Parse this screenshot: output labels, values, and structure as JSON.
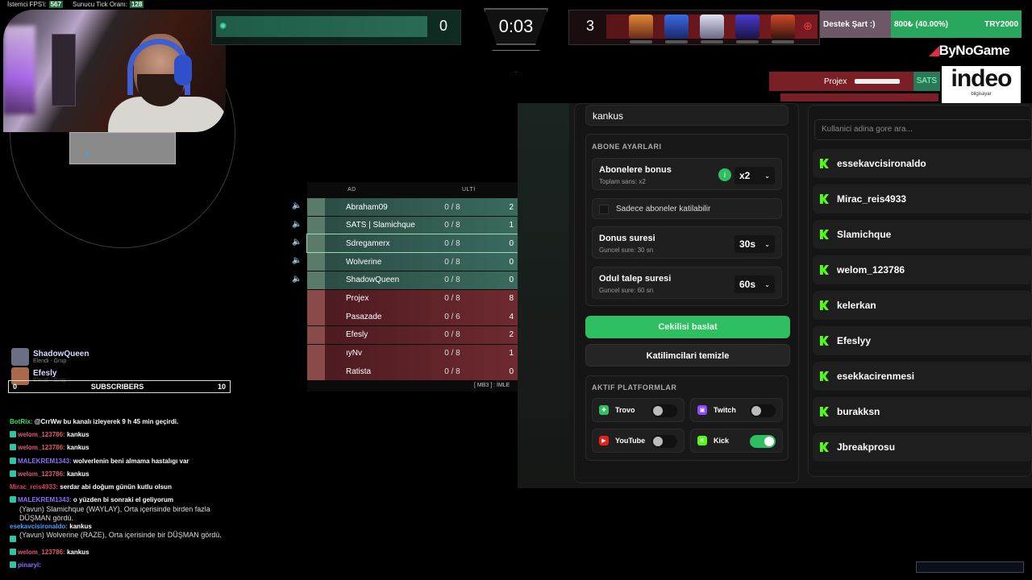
{
  "stats": {
    "client_fps_label": "İstemci FPS'i:",
    "client_fps": "567",
    "server_tick_label": "Sunucu Tick Oranı:",
    "server_tick": "128"
  },
  "hud": {
    "score_left": "0",
    "timer": "0:03",
    "score_right": "3"
  },
  "donation": {
    "label": "Destek Şart :)",
    "progress_text": "800₺ (40.00%)",
    "goal": "TRY2000",
    "progress": 0.4
  },
  "sponsors": {
    "bynogame": "ByNoGame",
    "indeo": "indeo",
    "indeo_sub": "bilgisayar"
  },
  "killfeed": {
    "player": "Projex",
    "tag": "SATS"
  },
  "scoreboard": {
    "headers": {
      "name": "AD",
      "ult": "ULTİ"
    },
    "rows": [
      {
        "name": "Abraham09",
        "ult": "0 / 8",
        "k": "2",
        "team": "ally"
      },
      {
        "name": "SATS | Slamichque",
        "ult": "0 / 8",
        "k": "1",
        "team": "ally"
      },
      {
        "name": "Sdregamerx",
        "ult": "0 / 8",
        "k": "0",
        "team": "ally"
      },
      {
        "name": "Wolverine",
        "ult": "0 / 8",
        "k": "0",
        "team": "ally"
      },
      {
        "name": "ShadowQueen",
        "ult": "0 / 8",
        "k": "0",
        "team": "ally"
      },
      {
        "name": "Projex",
        "ult": "0 / 8",
        "k": "8",
        "team": "enemy"
      },
      {
        "name": "Pasazade",
        "ult": "0 / 6",
        "k": "4",
        "team": "enemy"
      },
      {
        "name": "Efesly",
        "ult": "0 / 8",
        "k": "2",
        "team": "enemy"
      },
      {
        "name": "ıyNv",
        "ult": "0 / 8",
        "k": "1",
        "team": "enemy"
      },
      {
        "name": "Ratista",
        "ult": "0 / 8",
        "k": "0",
        "team": "enemy"
      }
    ],
    "footer": "[ MB3 ] : İMLE"
  },
  "toasts": [
    {
      "name": "ShadowQueen",
      "sub": "Elendi - Grup"
    },
    {
      "name": "Efesly",
      "sub": "Elendi - Grup"
    }
  ],
  "subscribers": {
    "left": "0",
    "label": "SUBSCRIBERS",
    "right": "10"
  },
  "chat": [
    {
      "user": "BotRix:",
      "color": "#43e05a",
      "msg": "@CrrWw bu kanalı izleyerek 9 h 45 min geçirdi.",
      "badge": false
    },
    {
      "user": "welom_123786:",
      "color": "#e05a6a",
      "msg": "kankus",
      "badge": true
    },
    {
      "user": "welom_123786:",
      "color": "#e05a6a",
      "msg": "kankus",
      "badge": true
    },
    {
      "user": "MALEKREM1343:",
      "color": "#8f6cff",
      "msg": "wolverlenin beni almama hastalıgı var",
      "badge": true
    },
    {
      "user": "welom_123786:",
      "color": "#e05a6a",
      "msg": "kankus",
      "badge": true
    },
    {
      "user": "Mirac_reis4933:",
      "color": "#d9435a",
      "msg": "serdar abi doğum günün kutlu olsun",
      "badge": false
    },
    {
      "user": "MALEKREM1343:",
      "color": "#8f6cff",
      "msg": "o yüzden bi sonraki el geliyorum",
      "badge": true
    },
    {
      "user": "",
      "color": "#ffffff",
      "msg": "",
      "badge": false
    },
    {
      "user": "esekavcisironaldo:",
      "color": "#4aa0ff",
      "msg": "kankus",
      "badge": false
    },
    {
      "user": "",
      "color": "#ffffff",
      "msg": "",
      "badge": true
    },
    {
      "user": "welom_123786:",
      "color": "#e05a6a",
      "msg": "kankus",
      "badge": true
    },
    {
      "user": "pinaryl:",
      "color": "#8f6cff",
      "msg": "",
      "badge": true
    }
  ],
  "events": {
    "e1": "(Yavun) Slamichque (WAYLAY), Orta  içerisinde birden fazla DÜŞMAN gördü.",
    "e2": "(Yavun) Wolverine (RAZE), Orta  içerisinde bir DÜŞMAN gördü."
  },
  "panel": {
    "keyword": "kankus",
    "sub_settings_title": "ABONE AYARLARI",
    "sub_bonus_label": "Abonelere bonus",
    "sub_bonus_sub": "Toplam sans: x2",
    "sub_bonus_value": "x2",
    "subs_only_label": "Sadece aboneler katilabilir",
    "spin_label": "Donus suresi",
    "spin_sub": "Guncel sure: 30 sn",
    "spin_value": "30s",
    "claim_label": "Odul talep suresi",
    "claim_sub": "Guncel sure: 60 sn",
    "claim_value": "60s",
    "start_button": "Cekilisi baslat",
    "clear_button": "Katilimcilari temizle",
    "platforms_title": "AKTIF PLATFORMLAR",
    "platforms": [
      {
        "name": "Trovo",
        "on": false,
        "color": "#2fbf62"
      },
      {
        "name": "Twitch",
        "on": false,
        "color": "#9146ff"
      },
      {
        "name": "YouTube",
        "on": false,
        "color": "#e62117"
      },
      {
        "name": "Kick",
        "on": true,
        "color": "#53fc18"
      }
    ],
    "search_placeholder": "Kullanici adina gore ara...",
    "participants": [
      "essekavcisironaldo",
      "Mirac_reis4933",
      "Slamichque",
      "welom_123786",
      "kelerkan",
      "Efeslyy",
      "esekkacirenmesi",
      "burakksn",
      "Jbreakprosu"
    ]
  }
}
